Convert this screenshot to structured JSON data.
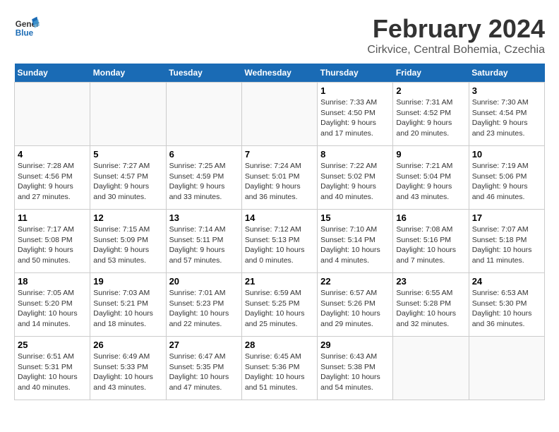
{
  "header": {
    "logo_line1": "General",
    "logo_line2": "Blue",
    "title": "February 2024",
    "subtitle": "Cirkvice, Central Bohemia, Czechia"
  },
  "calendar": {
    "weekdays": [
      "Sunday",
      "Monday",
      "Tuesday",
      "Wednesday",
      "Thursday",
      "Friday",
      "Saturday"
    ],
    "weeks": [
      [
        {
          "day": "",
          "info": ""
        },
        {
          "day": "",
          "info": ""
        },
        {
          "day": "",
          "info": ""
        },
        {
          "day": "",
          "info": ""
        },
        {
          "day": "1",
          "info": "Sunrise: 7:33 AM\nSunset: 4:50 PM\nDaylight: 9 hours\nand 17 minutes."
        },
        {
          "day": "2",
          "info": "Sunrise: 7:31 AM\nSunset: 4:52 PM\nDaylight: 9 hours\nand 20 minutes."
        },
        {
          "day": "3",
          "info": "Sunrise: 7:30 AM\nSunset: 4:54 PM\nDaylight: 9 hours\nand 23 minutes."
        }
      ],
      [
        {
          "day": "4",
          "info": "Sunrise: 7:28 AM\nSunset: 4:56 PM\nDaylight: 9 hours\nand 27 minutes."
        },
        {
          "day": "5",
          "info": "Sunrise: 7:27 AM\nSunset: 4:57 PM\nDaylight: 9 hours\nand 30 minutes."
        },
        {
          "day": "6",
          "info": "Sunrise: 7:25 AM\nSunset: 4:59 PM\nDaylight: 9 hours\nand 33 minutes."
        },
        {
          "day": "7",
          "info": "Sunrise: 7:24 AM\nSunset: 5:01 PM\nDaylight: 9 hours\nand 36 minutes."
        },
        {
          "day": "8",
          "info": "Sunrise: 7:22 AM\nSunset: 5:02 PM\nDaylight: 9 hours\nand 40 minutes."
        },
        {
          "day": "9",
          "info": "Sunrise: 7:21 AM\nSunset: 5:04 PM\nDaylight: 9 hours\nand 43 minutes."
        },
        {
          "day": "10",
          "info": "Sunrise: 7:19 AM\nSunset: 5:06 PM\nDaylight: 9 hours\nand 46 minutes."
        }
      ],
      [
        {
          "day": "11",
          "info": "Sunrise: 7:17 AM\nSunset: 5:08 PM\nDaylight: 9 hours\nand 50 minutes."
        },
        {
          "day": "12",
          "info": "Sunrise: 7:15 AM\nSunset: 5:09 PM\nDaylight: 9 hours\nand 53 minutes."
        },
        {
          "day": "13",
          "info": "Sunrise: 7:14 AM\nSunset: 5:11 PM\nDaylight: 9 hours\nand 57 minutes."
        },
        {
          "day": "14",
          "info": "Sunrise: 7:12 AM\nSunset: 5:13 PM\nDaylight: 10 hours\nand 0 minutes."
        },
        {
          "day": "15",
          "info": "Sunrise: 7:10 AM\nSunset: 5:14 PM\nDaylight: 10 hours\nand 4 minutes."
        },
        {
          "day": "16",
          "info": "Sunrise: 7:08 AM\nSunset: 5:16 PM\nDaylight: 10 hours\nand 7 minutes."
        },
        {
          "day": "17",
          "info": "Sunrise: 7:07 AM\nSunset: 5:18 PM\nDaylight: 10 hours\nand 11 minutes."
        }
      ],
      [
        {
          "day": "18",
          "info": "Sunrise: 7:05 AM\nSunset: 5:20 PM\nDaylight: 10 hours\nand 14 minutes."
        },
        {
          "day": "19",
          "info": "Sunrise: 7:03 AM\nSunset: 5:21 PM\nDaylight: 10 hours\nand 18 minutes."
        },
        {
          "day": "20",
          "info": "Sunrise: 7:01 AM\nSunset: 5:23 PM\nDaylight: 10 hours\nand 22 minutes."
        },
        {
          "day": "21",
          "info": "Sunrise: 6:59 AM\nSunset: 5:25 PM\nDaylight: 10 hours\nand 25 minutes."
        },
        {
          "day": "22",
          "info": "Sunrise: 6:57 AM\nSunset: 5:26 PM\nDaylight: 10 hours\nand 29 minutes."
        },
        {
          "day": "23",
          "info": "Sunrise: 6:55 AM\nSunset: 5:28 PM\nDaylight: 10 hours\nand 32 minutes."
        },
        {
          "day": "24",
          "info": "Sunrise: 6:53 AM\nSunset: 5:30 PM\nDaylight: 10 hours\nand 36 minutes."
        }
      ],
      [
        {
          "day": "25",
          "info": "Sunrise: 6:51 AM\nSunset: 5:31 PM\nDaylight: 10 hours\nand 40 minutes."
        },
        {
          "day": "26",
          "info": "Sunrise: 6:49 AM\nSunset: 5:33 PM\nDaylight: 10 hours\nand 43 minutes."
        },
        {
          "day": "27",
          "info": "Sunrise: 6:47 AM\nSunset: 5:35 PM\nDaylight: 10 hours\nand 47 minutes."
        },
        {
          "day": "28",
          "info": "Sunrise: 6:45 AM\nSunset: 5:36 PM\nDaylight: 10 hours\nand 51 minutes."
        },
        {
          "day": "29",
          "info": "Sunrise: 6:43 AM\nSunset: 5:38 PM\nDaylight: 10 hours\nand 54 minutes."
        },
        {
          "day": "",
          "info": ""
        },
        {
          "day": "",
          "info": ""
        }
      ]
    ]
  }
}
